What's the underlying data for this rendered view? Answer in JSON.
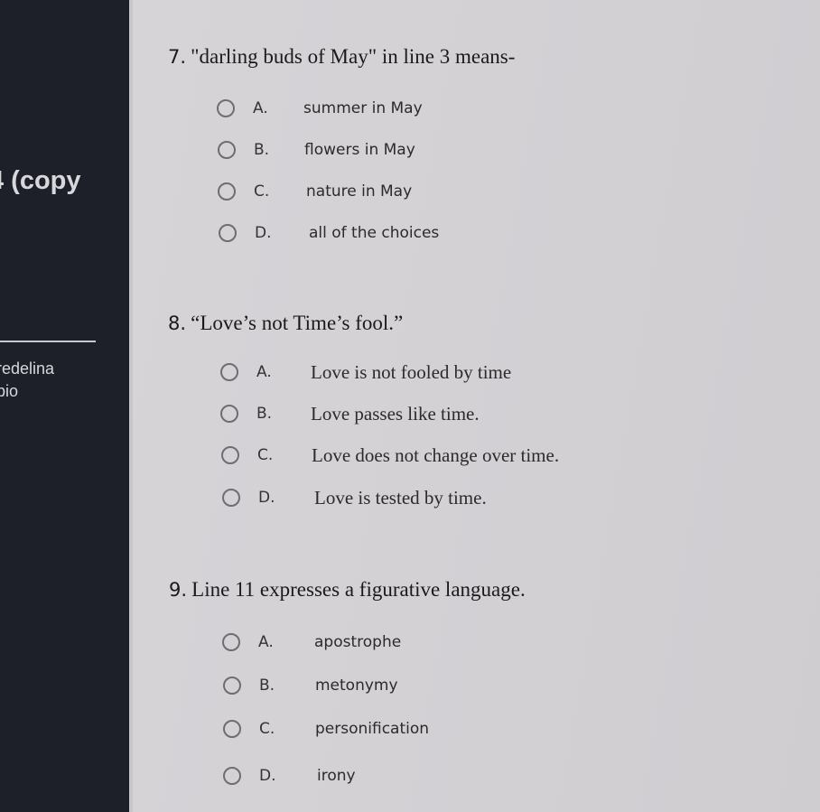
{
  "sidebar": {
    "title": "4 (copy",
    "user_line1": "redelina",
    "user_line2": "bio"
  },
  "questions": [
    {
      "number": "7.",
      "text": "\"darling buds of May\" in line 3 means-",
      "options": [
        {
          "letter": "A.",
          "text": "summer in May"
        },
        {
          "letter": "B.",
          "text": "flowers in May"
        },
        {
          "letter": "C.",
          "text": "nature in May"
        },
        {
          "letter": "D.",
          "text": "all of the choices"
        }
      ]
    },
    {
      "number": "8.",
      "text": "“Love’s not Time’s fool.”",
      "options": [
        {
          "letter": "A.",
          "text": "Love is not fooled by time"
        },
        {
          "letter": "B.",
          "text": "Love passes like time."
        },
        {
          "letter": "C.",
          "text": "Love does not change over time."
        },
        {
          "letter": "D.",
          "text": "Love is tested by time."
        }
      ]
    },
    {
      "number": "9.",
      "text": "Line 11 expresses a figurative language.",
      "options": [
        {
          "letter": "A.",
          "text": "apostrophe"
        },
        {
          "letter": "B.",
          "text": "metonymy"
        },
        {
          "letter": "C.",
          "text": "personification"
        },
        {
          "letter": "D.",
          "text": "irony"
        }
      ]
    }
  ]
}
